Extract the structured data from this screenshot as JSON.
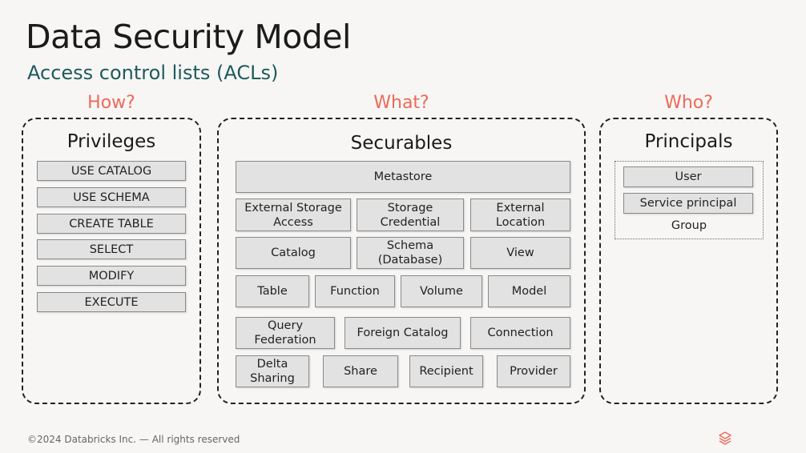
{
  "title": "Data Security Model",
  "subtitle": "Access control lists (ACLs)",
  "headings": {
    "how": "How?",
    "what": "What?",
    "who": "Who?"
  },
  "privileges": {
    "title": "Privileges",
    "items": [
      "USE CATALOG",
      "USE SCHEMA",
      "CREATE TABLE",
      "SELECT",
      "MODIFY",
      "EXECUTE"
    ]
  },
  "securables": {
    "title": "Securables",
    "items": [
      "Metastore",
      "External Storage\nAccess",
      "Storage\nCredential",
      "External\nLocation",
      "Catalog",
      "Schema\n(Database)",
      "View",
      "Table",
      "Function",
      "Volume",
      "Model",
      "Query\nFederation",
      "Foreign Catalog",
      "Connection",
      "Delta\nSharing",
      "Share",
      "Recipient",
      "Provider"
    ]
  },
  "principals": {
    "title": "Principals",
    "items": [
      "User",
      "Service principal"
    ],
    "group_label": "Group"
  },
  "footer": "©2024 Databricks Inc. — All rights reserved",
  "colors": {
    "accent": "#ec6a5a",
    "subtitle": "#1e5a5e",
    "box": "#e2e2e2",
    "logo": "#ec6a5a"
  },
  "icons": {
    "logo": "databricks-logo-icon"
  }
}
